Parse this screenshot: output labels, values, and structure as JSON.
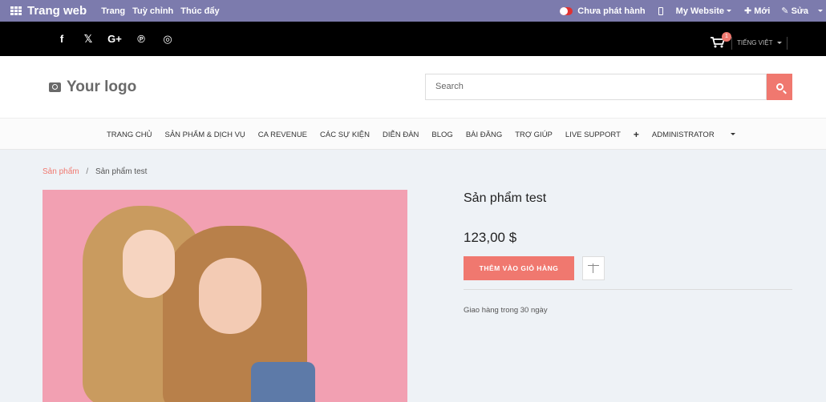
{
  "adminbar": {
    "brand": "Trang web",
    "menu": [
      "Trang",
      "Tuỳ chỉnh",
      "Thúc đẩy"
    ],
    "publish_status": "Chưa phát hành",
    "website": "My Website",
    "new": "Mới",
    "edit": "Sửa"
  },
  "social": {
    "icons": [
      "facebook-icon",
      "twitter-icon",
      "google-plus-icon",
      "pinterest-icon",
      "instagram-icon"
    ],
    "glyphs": [
      "f",
      "𝕏",
      "G+",
      "℗",
      "◎"
    ],
    "cart_count": "1",
    "language": "TIẾNG VIỆT"
  },
  "header": {
    "logo_text": "Your logo",
    "search_placeholder": "Search"
  },
  "nav": {
    "items": [
      "TRANG CHỦ",
      "SẢN PHẨM & DỊCH VỤ",
      "CA REVENUE",
      "CÁC SỰ KIỆN",
      "DIỄN ĐÀN",
      "BLOG",
      "BÀI ĐĂNG",
      "TRỢ GIÚP",
      "LIVE SUPPORT"
    ],
    "plus": "+",
    "admin": "ADMINISTRATOR"
  },
  "breadcrumb": {
    "parent": "Sản phẩm",
    "separator": "/",
    "current": "Sản phẩm test"
  },
  "product": {
    "title": "Sản phẩm test",
    "price": "123,00 $",
    "add_to_cart": "THÊM VÀO GIỎ HÀNG",
    "shipping": "Giao hàng trong 30 ngày"
  },
  "colors": {
    "admin_bar": "#7c7bad",
    "accent": "#f0786f",
    "social_bar": "#000000"
  }
}
